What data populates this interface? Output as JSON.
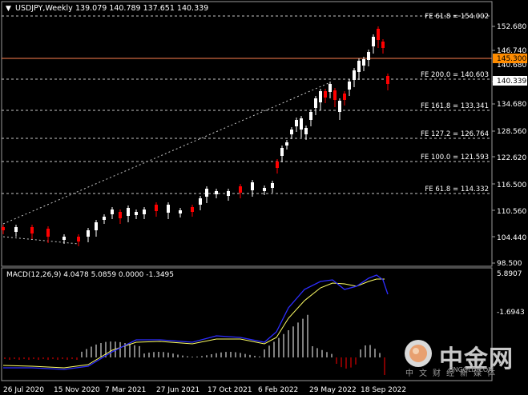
{
  "header": {
    "symbol_tf": "USDJPY,Weekly",
    "ohlc": "139.079 140.789 137.651 140.339"
  },
  "macd": {
    "label": "MACD(12,26,9) 4.0478 5.0859 0.0000 -1.3495"
  },
  "colors": {
    "background": "#000000",
    "grid": "#9a9a9a",
    "bull": "#ffffff",
    "bear": "#ff0000",
    "hline": "#ff7f50",
    "macd_line": "#2d2dff",
    "signal_line": "#ffff66",
    "price_tag_bg": "#ff8c00"
  },
  "price_axis": {
    "ticks": [
      "152.680",
      "146.740",
      "140.680",
      "134.680",
      "128.560",
      "122.620",
      "116.500",
      "110.560",
      "104.440",
      "98.500"
    ]
  },
  "macd_axis": {
    "ticks": [
      "5.8907",
      "-1.6943"
    ]
  },
  "current_price_label": "140.339",
  "hline_label": "145.300",
  "fib_levels": [
    {
      "label": "FE 61.8 = 154.002",
      "value": 154.002
    },
    {
      "label": "FE 200.0 = 140.603",
      "value": 140.603
    },
    {
      "label": "FE 161.8 = 133.341",
      "value": 133.341
    },
    {
      "label": "FE 127.2 = 126.764",
      "value": 126.764
    },
    {
      "label": "FE 100.0 = 121.593",
      "value": 121.593
    },
    {
      "label": "FE 61.8 = 114.332",
      "value": 114.332
    }
  ],
  "time_axis": {
    "labels": [
      "26 Jul 2020",
      "15 Nov 2020",
      "7 Mar 2021",
      "27 Jun 2021",
      "17 Oct 2021",
      "6 Feb 2022",
      "29 May 2022",
      "18 Sep 2022"
    ]
  },
  "watermark": {
    "brand": "中金网",
    "sub": "中文财经新媒体",
    "url": "CNGOLD.COM"
  }
}
